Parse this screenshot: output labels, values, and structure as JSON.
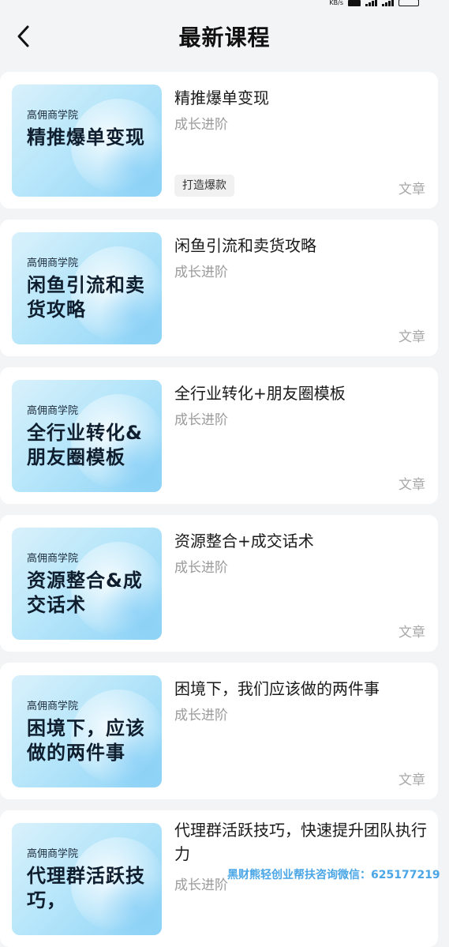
{
  "header": {
    "title": "最新课程",
    "back_icon": "chevron-left-icon"
  },
  "courses": [
    {
      "thumb_brand": "高佣商学院",
      "thumb_title": "精推爆单变现",
      "title": "精推爆单变现",
      "subtitle": "成长进阶",
      "tag": "打造爆款",
      "type": "文章"
    },
    {
      "thumb_brand": "高佣商学院",
      "thumb_title": "闲鱼引流和卖货攻略",
      "title": "闲鱼引流和卖货攻略",
      "subtitle": "成长进阶",
      "tag": "",
      "type": "文章"
    },
    {
      "thumb_brand": "高佣商学院",
      "thumb_title": "全行业转化&朋友圈模板",
      "title": "全行业转化+朋友圈模板",
      "subtitle": "成长进阶",
      "tag": "",
      "type": "文章"
    },
    {
      "thumb_brand": "高佣商学院",
      "thumb_title": "资源整合&成交话术",
      "title": "资源整合+成交话术",
      "subtitle": "成长进阶",
      "tag": "",
      "type": "文章"
    },
    {
      "thumb_brand": "高佣商学院",
      "thumb_title": "困境下，应该做的两件事",
      "title": "困境下，我们应该做的两件事",
      "subtitle": "成长进阶",
      "tag": "",
      "type": "文章"
    },
    {
      "thumb_brand": "高佣商学院",
      "thumb_title": "代理群活跃技巧，",
      "title": "代理群活跃技巧，快速提升团队执行力",
      "subtitle": "成长进阶",
      "tag": "",
      "type": ""
    }
  ],
  "watermark": "黑财熊轻创业帮扶咨询微信：625177219",
  "colors": {
    "background": "#f3f4f6",
    "card": "#ffffff",
    "thumb_accent": "#8fd3f6",
    "watermark": "#4aa6e6"
  }
}
